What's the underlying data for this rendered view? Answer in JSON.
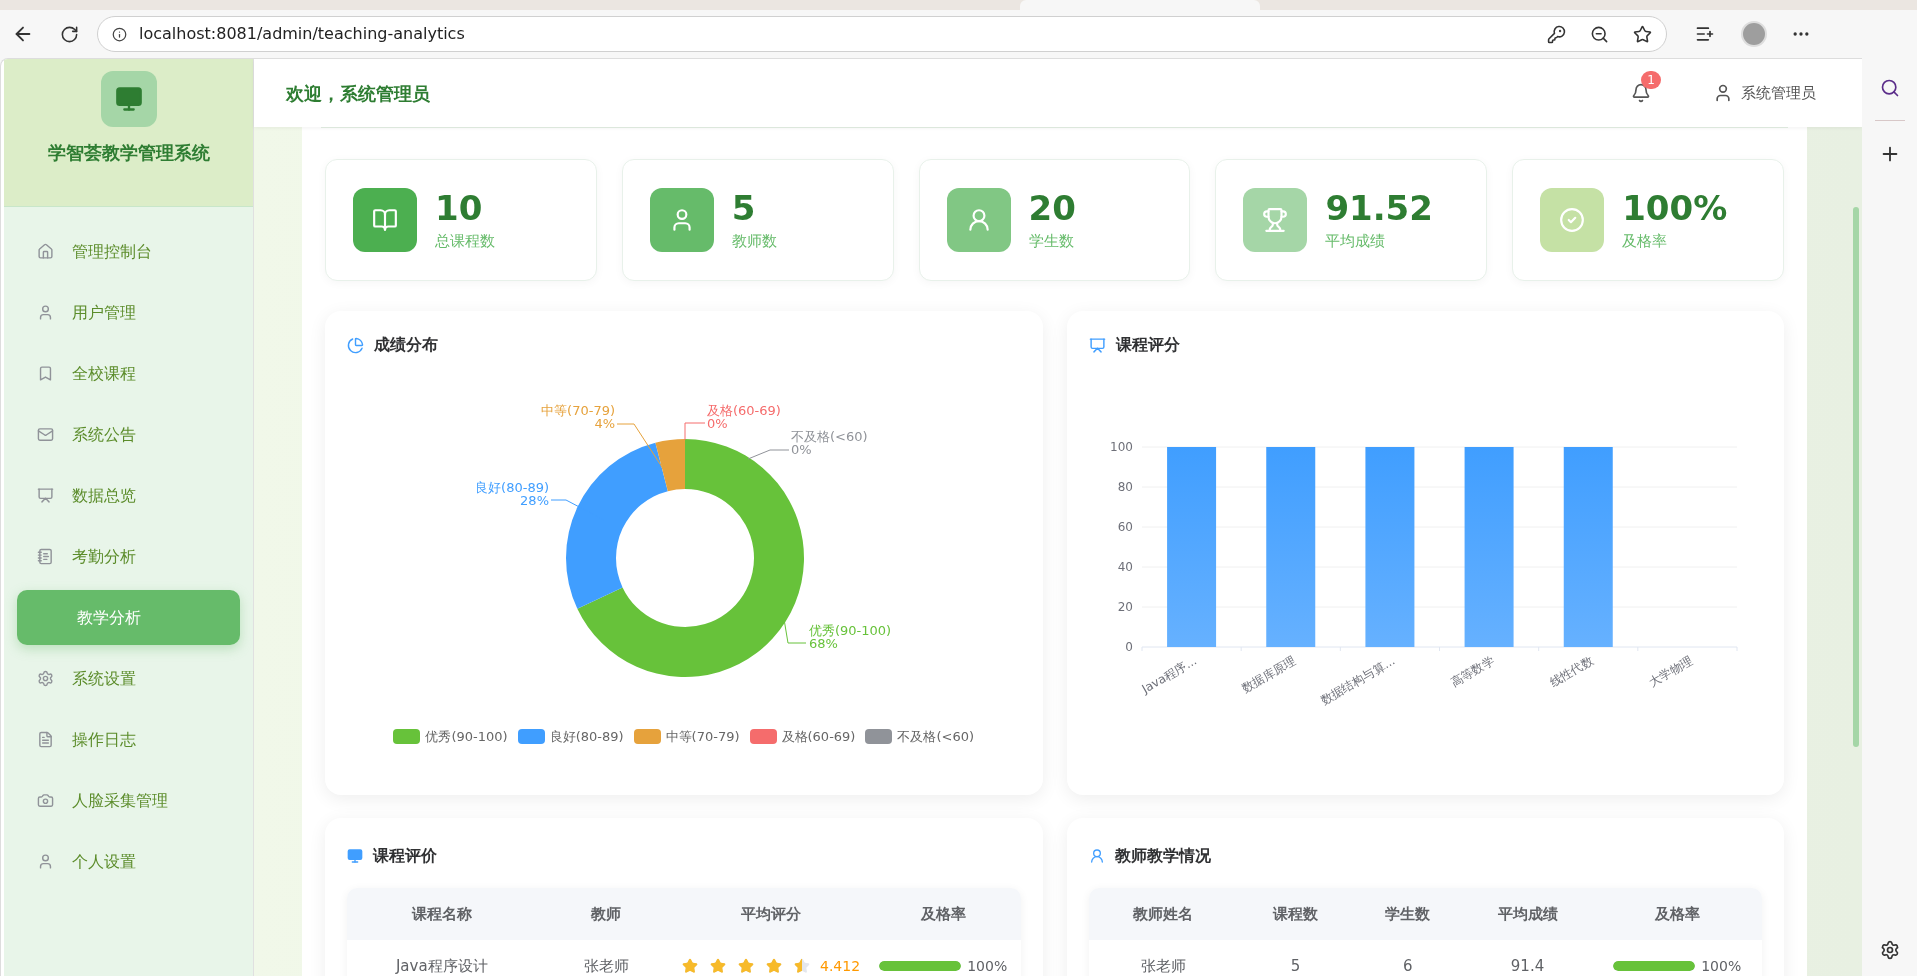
{
  "browser": {
    "url": "localhost:8081/admin/teaching-analytics"
  },
  "sidebar": {
    "title": "学智荟教学管理系统",
    "items": [
      {
        "label": "管理控制台",
        "selected": false
      },
      {
        "label": "用户管理",
        "selected": false
      },
      {
        "label": "全校课程",
        "selected": false
      },
      {
        "label": "系统公告",
        "selected": false
      },
      {
        "label": "数据总览",
        "selected": false
      },
      {
        "label": "考勤分析",
        "selected": false
      },
      {
        "label": "教学分析",
        "selected": true
      },
      {
        "label": "系统设置",
        "selected": false
      },
      {
        "label": "操作日志",
        "selected": false
      },
      {
        "label": "人脸采集管理",
        "selected": false
      },
      {
        "label": "个人设置",
        "selected": false
      }
    ]
  },
  "header": {
    "welcome": "欢迎，系统管理员",
    "notification_count": "1",
    "user": "系统管理员"
  },
  "stats": [
    {
      "value": "10",
      "label": "总课程数"
    },
    {
      "value": "5",
      "label": "教师数"
    },
    {
      "value": "20",
      "label": "学生数"
    },
    {
      "value": "91.52",
      "label": "平均成绩"
    },
    {
      "value": "100%",
      "label": "及格率"
    }
  ],
  "grade_distribution": {
    "title": "成绩分布",
    "chart_data": {
      "type": "donut",
      "categories": [
        "优秀(90-100)",
        "良好(80-89)",
        "中等(70-79)",
        "及格(60-69)",
        "不及格(<60)"
      ],
      "values": [
        68,
        28,
        4,
        0,
        0
      ],
      "colors": [
        "#67c23a",
        "#409eff",
        "#e6a23c",
        "#f56c6c",
        "#909399"
      ],
      "value_labels": [
        "68%",
        "28%",
        "4%",
        "0%",
        "0%"
      ],
      "legend": "bottom"
    }
  },
  "course_rating": {
    "title": "课程评分",
    "chart_data": {
      "type": "bar",
      "categories": [
        "Java程序...",
        "数据库原理",
        "数据结构与算...",
        "高等数学",
        "线性代数",
        "大学物理"
      ],
      "values": [
        100,
        100,
        100,
        100,
        100,
        0
      ],
      "grid": true,
      "ylim": [
        0,
        100
      ],
      "yticks": [
        0,
        20,
        40,
        60,
        80,
        100
      ]
    }
  },
  "course_evaluation": {
    "title": "课程评价",
    "columns": [
      "课程名称",
      "教师",
      "平均评分",
      "及格率"
    ],
    "rows": [
      {
        "course": "Java程序设计",
        "teacher": "张老师",
        "stars": 4.5,
        "rating": "4.412",
        "level": 1,
        "pass_rate": "100%"
      }
    ]
  },
  "teacher_stats": {
    "title": "教师教学情况",
    "columns": [
      "教师姓名",
      "课程数",
      "学生数",
      "平均成绩",
      "及格率"
    ],
    "rows": [
      {
        "name": "张老师",
        "courses": "5",
        "students": "6",
        "avg_score": "91.4",
        "level": 1,
        "pass_rate": "100%"
      }
    ]
  }
}
